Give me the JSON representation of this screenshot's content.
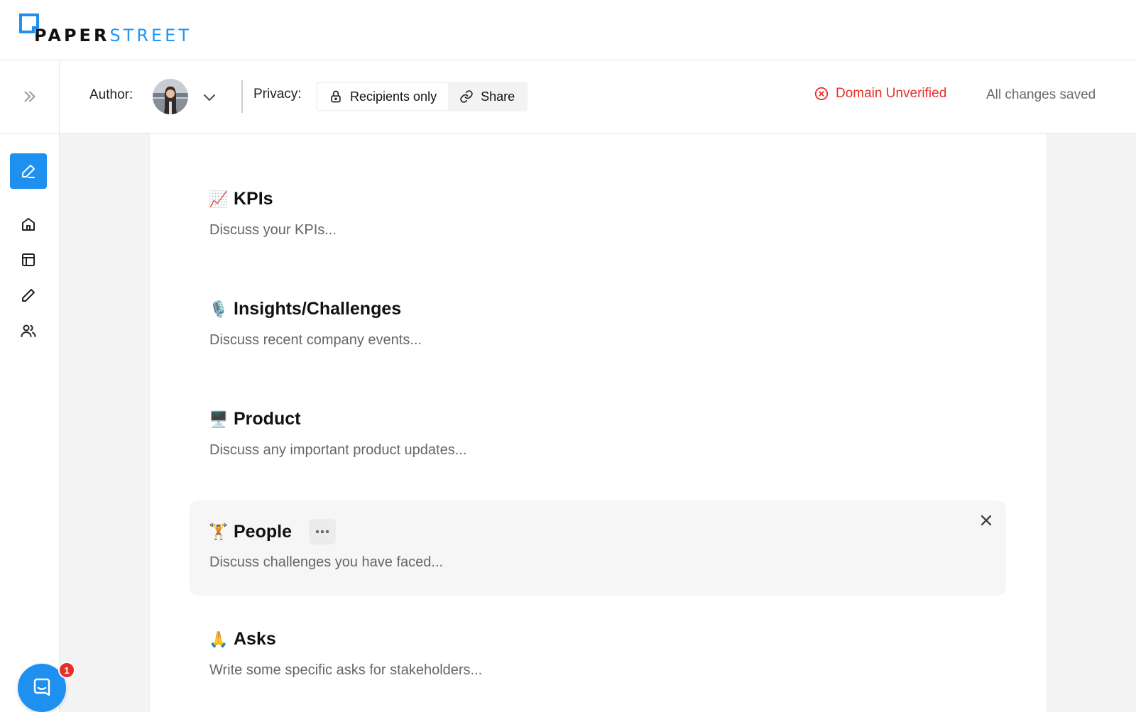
{
  "brand": {
    "name_part1": "PAPER",
    "name_part2": "STREET",
    "accent": "#1e90f0"
  },
  "toolbar": {
    "expand_icon": "chevrons-right-icon",
    "author_label": "Author:",
    "privacy_label": "Privacy:",
    "privacy_options": [
      {
        "label": "Recipients only",
        "icon": "lock-icon",
        "active": true
      },
      {
        "label": "Share",
        "icon": "link-icon",
        "active": false
      }
    ],
    "domain_status": "Domain Unverified",
    "domain_status_color": "#e5302a",
    "save_status": "All changes saved"
  },
  "sidebar": {
    "items": [
      {
        "name": "edit",
        "icon": "pen-icon",
        "active": true
      },
      {
        "name": "home",
        "icon": "home-icon"
      },
      {
        "name": "templates",
        "icon": "layout-icon"
      },
      {
        "name": "drafts",
        "icon": "pencil-icon"
      },
      {
        "name": "contacts",
        "icon": "users-icon"
      }
    ]
  },
  "sections": [
    {
      "emoji": "📈",
      "title": "KPIs",
      "description": "Discuss your KPIs..."
    },
    {
      "emoji": "🎙️",
      "title": "Insights/Challenges",
      "description": "Discuss recent company events..."
    },
    {
      "emoji": "🖥️",
      "title": "Product",
      "description": "Discuss any important product updates..."
    },
    {
      "emoji": "🏋️",
      "title": "People",
      "description": "Discuss challenges you have faced..."
    },
    {
      "emoji": "🙏",
      "title": "Asks",
      "description": "Write some specific asks for stakeholders..."
    }
  ],
  "chat": {
    "badge_count": "1"
  }
}
